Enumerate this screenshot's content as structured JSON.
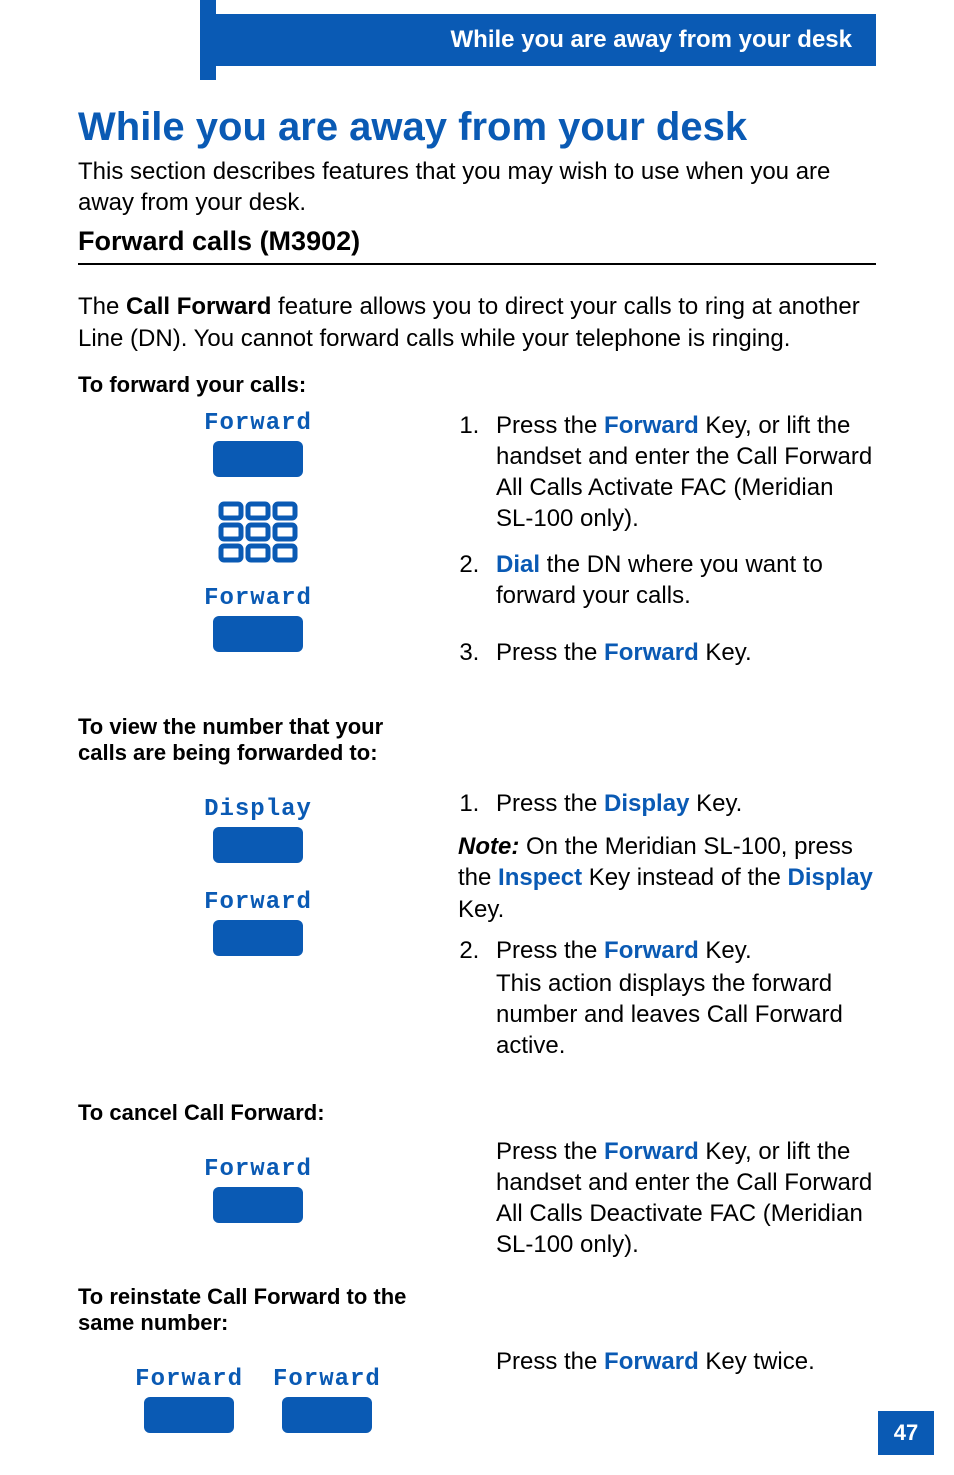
{
  "header": {
    "running_title": "While you are away from your desk"
  },
  "title": "While you are away from your desk",
  "intro": "This section describes features that you may wish to use when you are away from your desk.",
  "section_title": "Forward calls (M3902)",
  "section_intro_pre": "The ",
  "section_intro_bold": "Call Forward",
  "section_intro_post": " feature allows you to direct your calls to ring at another Line (DN). You cannot forward calls while your telephone is ringing.",
  "tasks": {
    "forward": {
      "label": "To forward your calls:",
      "keys": [
        "Forward",
        "Forward"
      ],
      "step1_pre": "Press the ",
      "step1_key": "Forward",
      "step1_post": " Key, or lift the handset and enter the Call Forward All Calls Activate FAC (Meridian SL-100 only).",
      "step2_key": "Dial",
      "step2_post": " the DN where you want to forward your calls.",
      "step3_pre": "Press the ",
      "step3_key": "Forward",
      "step3_post": " Key."
    },
    "view": {
      "label": "To view the number that your calls are being forwarded to:",
      "keys": [
        "Display",
        "Forward"
      ],
      "step1_pre": "Press the ",
      "step1_key": "Display",
      "step1_post": " Key.",
      "note_label": "Note:",
      "note_body_pre": " On the Meridian SL-100, press the ",
      "note_key1": "Inspect",
      "note_mid": " Key instead of the ",
      "note_key2": "Display",
      "note_post": " Key.",
      "step2_pre": "Press the ",
      "step2_key": "Forward",
      "step2_post": " Key.",
      "step2_sub": "This action displays the forward number and leaves Call Forward active."
    },
    "cancel": {
      "label": "To cancel Call Forward:",
      "keys": [
        "Forward"
      ],
      "body_pre": "Press the ",
      "body_key": "Forward",
      "body_post": " Key, or lift the handset and enter the Call Forward All Calls Deactivate FAC (Meridian SL-100 only)."
    },
    "reinstate": {
      "label": "To reinstate Call Forward to the same number:",
      "keys": [
        "Forward",
        "Forward"
      ],
      "body_pre": "Press the ",
      "body_key": "Forward",
      "body_post": " Key twice."
    }
  },
  "page_number": "47"
}
